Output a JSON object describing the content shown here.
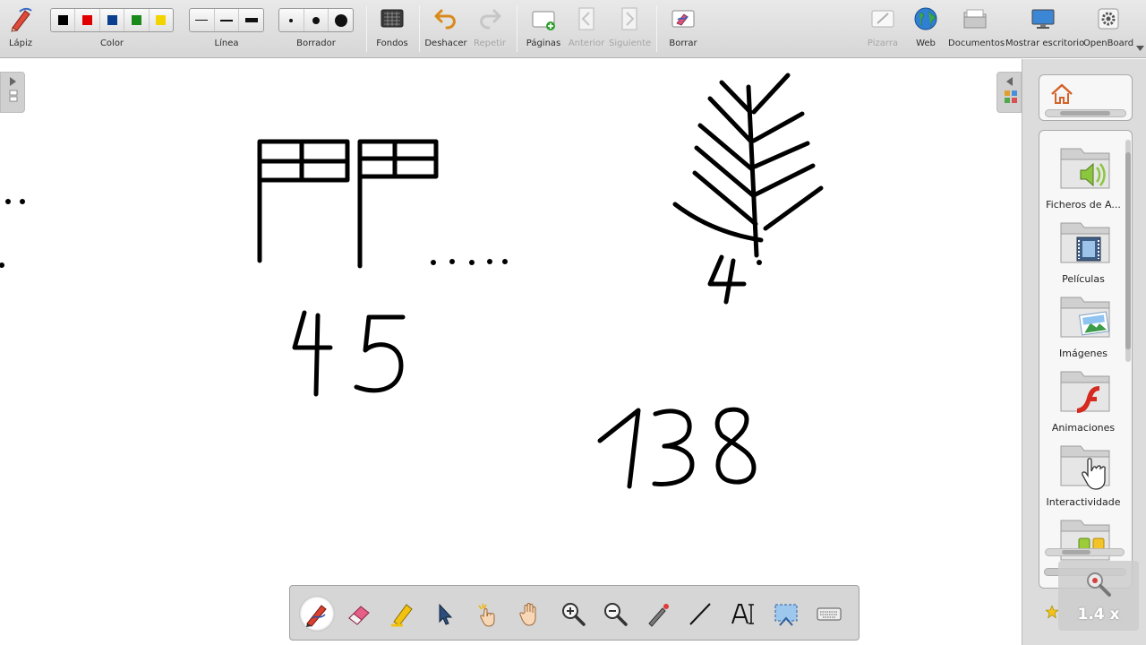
{
  "toolbar": {
    "pencil_label": "Lápiz",
    "color_label": "Color",
    "line_label": "Línea",
    "eraser_label": "Borrador",
    "backgrounds_label": "Fondos",
    "undo_label": "Deshacer",
    "redo_label": "Repetir",
    "pages_label": "Páginas",
    "previous_label": "Anterior",
    "next_label": "Siguiente",
    "clear_label": "Borrar",
    "board_label": "Pizarra",
    "web_label": "Web",
    "documents_label": "Documentos",
    "desktop_label": "Mostrar escritorio",
    "app_label": "OpenBoard",
    "colors": [
      "#000000",
      "#e00000",
      "#0a3f8f",
      "#1a8a1a",
      "#f2d400"
    ]
  },
  "library": {
    "folders": [
      {
        "label": "Ficheros de A...",
        "icon": "audio-folder-icon"
      },
      {
        "label": "Películas",
        "icon": "film-folder-icon"
      },
      {
        "label": "Imágenes",
        "icon": "images-folder-icon"
      },
      {
        "label": "Animaciones",
        "icon": "flash-folder-icon"
      },
      {
        "label": "Interactividade",
        "icon": "hand-folder-icon"
      },
      {
        "label": "",
        "icon": "apps-folder-icon"
      }
    ]
  },
  "canvas": {
    "number_1": "45",
    "number_2": "138",
    "digit_tree": "4",
    "dots_text": "....."
  },
  "zoom": {
    "value": "1.4 x"
  }
}
